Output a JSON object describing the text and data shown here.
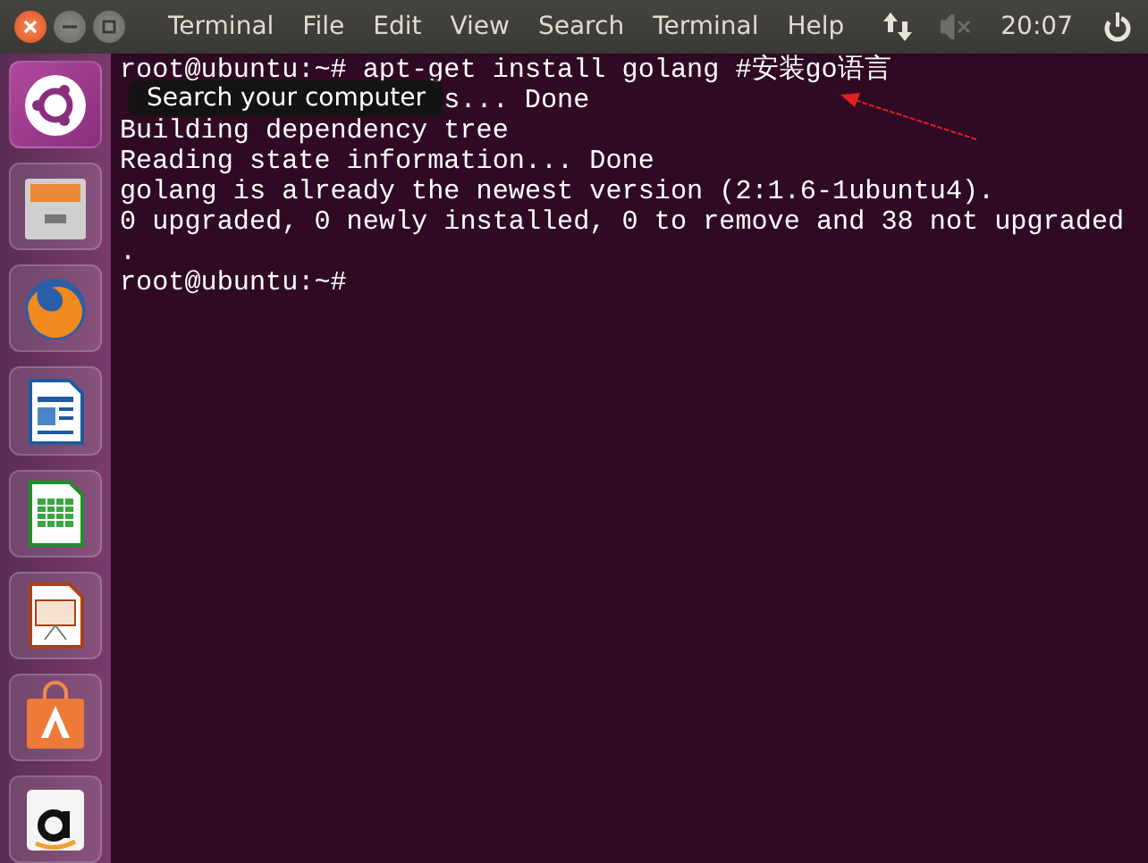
{
  "top_bar": {
    "menu": [
      "Terminal",
      "File",
      "Edit",
      "View",
      "Search",
      "Terminal",
      "Help"
    ],
    "indicators": {
      "clock": "20:07"
    }
  },
  "launcher": {
    "items": [
      {
        "kind": "dash",
        "selected": true
      },
      {
        "kind": "files",
        "selected": false
      },
      {
        "kind": "firefox",
        "selected": false
      },
      {
        "kind": "writer",
        "selected": false
      },
      {
        "kind": "calc",
        "selected": false
      },
      {
        "kind": "impress",
        "selected": false
      },
      {
        "kind": "software",
        "selected": false
      },
      {
        "kind": "amazon",
        "selected": false
      }
    ],
    "tooltip": "Search your computer"
  },
  "terminal": {
    "lines": [
      {
        "kind": "plain",
        "text": "root@ubuntu:~# apt-get install golang #安装go语言"
      },
      {
        "kind": "covered",
        "text": "s... Done"
      },
      {
        "kind": "plain",
        "text": "Building dependency tree"
      },
      {
        "kind": "plain",
        "text": "Reading state information... Done"
      },
      {
        "kind": "plain",
        "text": "golang is already the newest version (2:1.6-1ubuntu4)."
      },
      {
        "kind": "plain",
        "text": "0 upgraded, 0 newly installed, 0 to remove and 38 not upgraded"
      },
      {
        "kind": "plain",
        "text": "."
      },
      {
        "kind": "plain",
        "text": "root@ubuntu:~#"
      }
    ]
  }
}
